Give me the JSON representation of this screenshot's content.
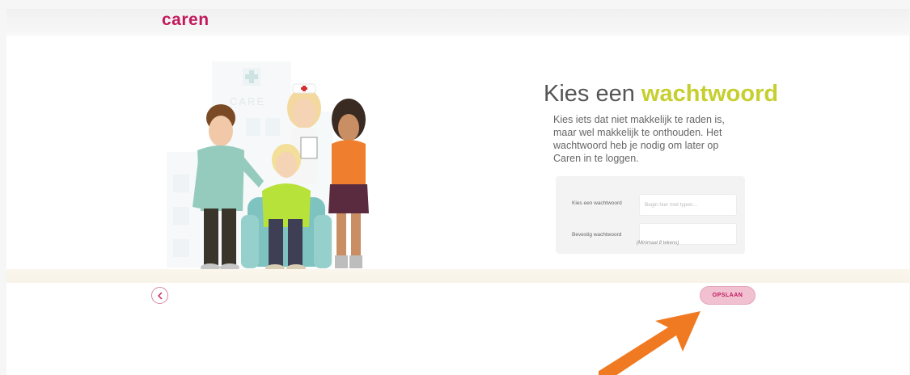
{
  "app": {
    "logo_text": "caren",
    "brand_color": "#c2185b"
  },
  "illustration": {
    "sign_text": "CARE"
  },
  "content": {
    "title_prefix": "Kies een",
    "title_accent": "wachtwoord",
    "accent_color": "#c6cf2f",
    "description": "Kies iets dat niet makkelijk te raden is, maar wel makkelijk te onthouden. Het wachtwoord heb je nodig om later op Caren in te loggen."
  },
  "form": {
    "password_label": "Kies een wachtwoord",
    "password_placeholder": "Begin hier met typen...",
    "password_value": "",
    "confirm_label": "Bevestig wachtwoord",
    "confirm_value": "",
    "hint": "(Minimaal 8 tekens)"
  },
  "footer": {
    "back_icon": "chevron-left-icon",
    "save_label": "OPSLAAN"
  },
  "annotation": {
    "arrow_icon": "arrow-up-right-icon",
    "arrow_color": "#ef7a22"
  }
}
